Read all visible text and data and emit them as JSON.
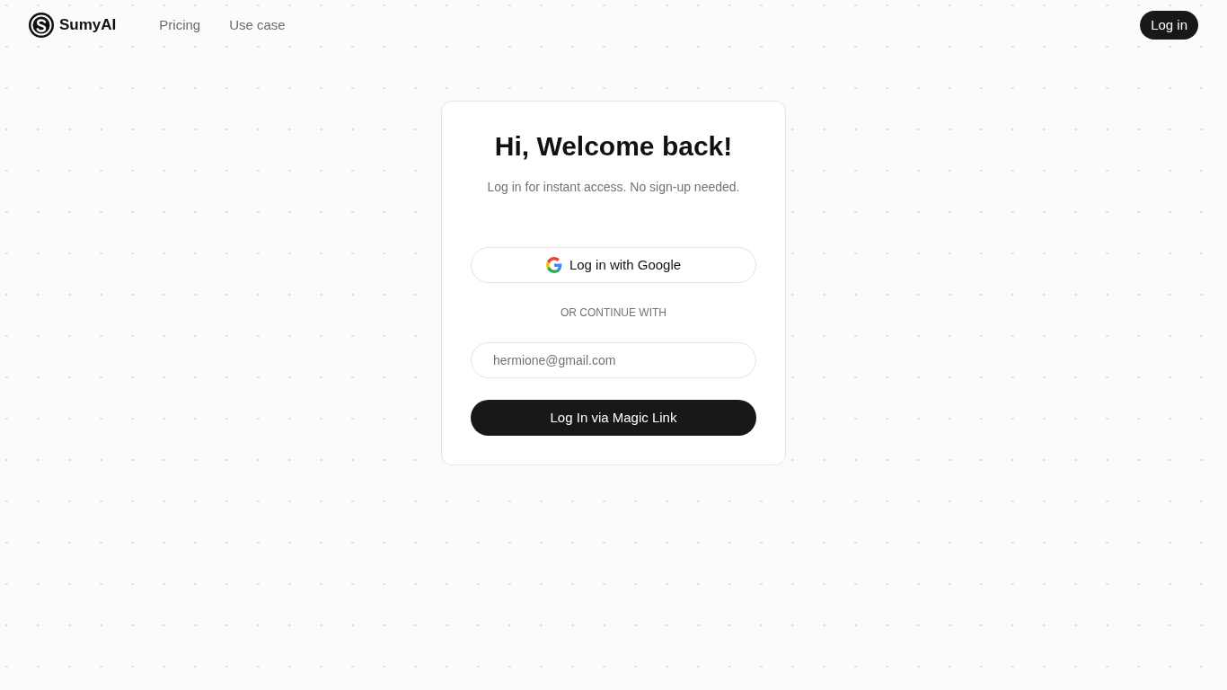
{
  "header": {
    "brand": "SumyAI",
    "nav": [
      "Pricing",
      "Use case"
    ],
    "login_button": "Log in"
  },
  "card": {
    "title": "Hi, Welcome back!",
    "subtitle": "Log in for instant access. No sign-up needed.",
    "google_button": "Log in with Google",
    "divider": "OR CONTINUE WITH",
    "email": {
      "placeholder": "hermione@gmail.com"
    },
    "submit_button": "Log In via Magic Link"
  }
}
